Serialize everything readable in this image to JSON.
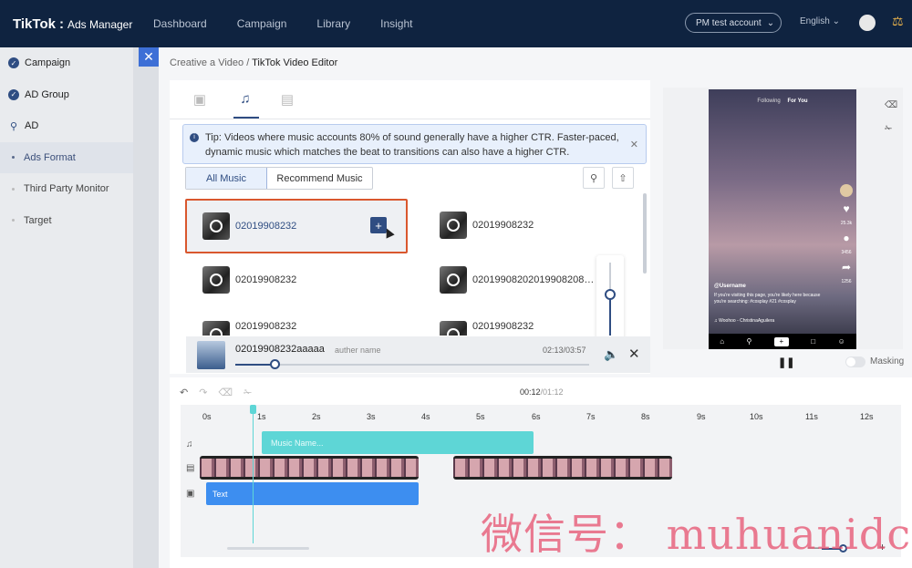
{
  "header": {
    "logo": "TikTok",
    "logo_sub": "Ads Manager",
    "nav": [
      "Dashboard",
      "Campaign",
      "Library",
      "Insight"
    ],
    "account": "PM test account",
    "language": "English"
  },
  "sidebar": {
    "items": [
      {
        "label": "Campaign"
      },
      {
        "label": "AD Group"
      },
      {
        "label": "AD"
      },
      {
        "label": "Ads Format"
      },
      {
        "label": "Third Party Monitor"
      },
      {
        "label": "Target"
      }
    ]
  },
  "breadcrumb": {
    "parent": "Creative a Video",
    "sep": "/",
    "current": "TikTok Video Editor"
  },
  "music_panel": {
    "tip": "Tip: Videos where music accounts 80% of sound generally have a higher CTR. Faster-paced, dynamic music which matches the beat to transitions can also have a higher CTR.",
    "segments": [
      "All Music",
      "Recommend Music"
    ],
    "tracks": [
      {
        "name": "02019908232"
      },
      {
        "name": "02019908232"
      },
      {
        "name": "02019908232"
      },
      {
        "name": "02019908202019908208…"
      },
      {
        "name": "02019908232"
      },
      {
        "name": "02019908232"
      }
    ],
    "player": {
      "title": "02019908232aaaaa",
      "author": "auther name",
      "time": "02:13/03:57",
      "progress": 0.11
    }
  },
  "preview": {
    "top_following": "Following",
    "top_foryou": "For You",
    "likes": "25.3k",
    "comments": "3456",
    "shares": "1256",
    "username": "@Username",
    "description": "If you're visiting this page, you're likely here because you're searching: #cosplay #21 #cosplay",
    "music": "Woohoo - ChristinaAguilera",
    "masking_label": "Masking"
  },
  "timeline": {
    "current": "00:12",
    "total": "/01:12",
    "ticks": [
      "0s",
      "1s",
      "2s",
      "3s",
      "4s",
      "5s",
      "6s",
      "7s",
      "8s",
      "9s",
      "10s",
      "11s",
      "12s"
    ],
    "music_clip": "Music Name...",
    "text_clip": "Text"
  },
  "watermark": "微信号： muhuanidc"
}
